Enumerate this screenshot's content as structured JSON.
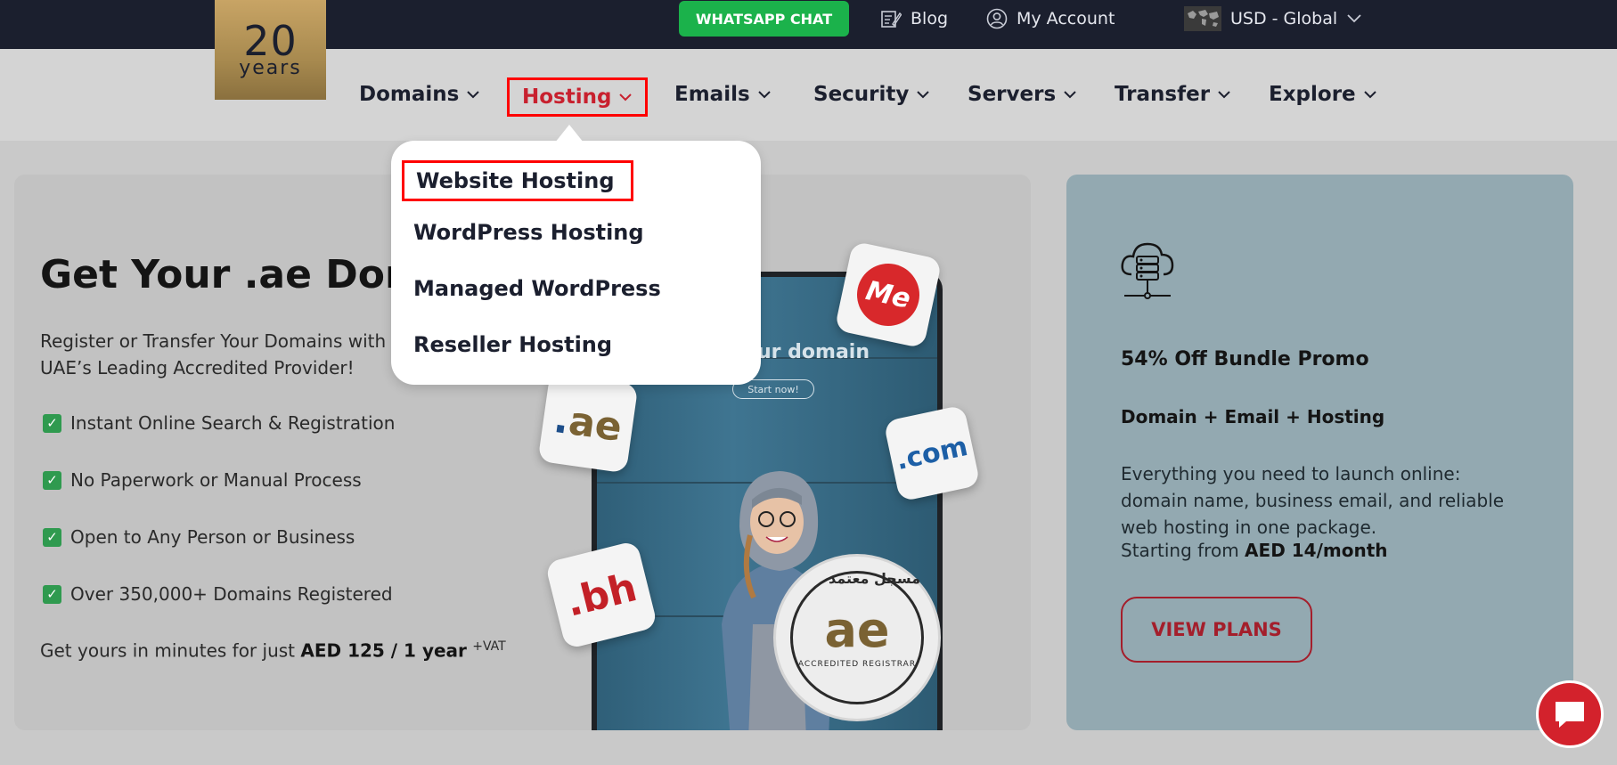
{
  "topbar": {
    "logo_number": "20",
    "logo_text": "years",
    "whatsapp_label": "WHATSAPP CHAT",
    "blog_label": "Blog",
    "account_label": "My Account",
    "currency_label": "USD - Global"
  },
  "nav": {
    "items": [
      {
        "label": "Domains"
      },
      {
        "label": "Hosting"
      },
      {
        "label": "Emails"
      },
      {
        "label": "Security"
      },
      {
        "label": "Servers"
      },
      {
        "label": "Transfer"
      },
      {
        "label": "Explore"
      }
    ],
    "active_color": "#c8202e"
  },
  "dropdown": {
    "items": [
      {
        "label": "Website Hosting"
      },
      {
        "label": "WordPress Hosting"
      },
      {
        "label": "Managed WordPress"
      },
      {
        "label": "Reseller Hosting"
      }
    ]
  },
  "hero": {
    "title": "Get Your .ae Domain",
    "subtitle": "Register or Transfer Your Domains with UAE’s Leading Accredited Provider!",
    "features": [
      "Instant Online Search & Registration",
      "No Paperwork or Manual Process",
      "Open to Any Person or Business",
      "Over 350,000+ Domains Registered"
    ],
    "price_prefix": "Get yours in minutes for just",
    "price_value": "AED 125 / 1 year",
    "price_suffix": "+VAT",
    "phone_text": "ur domain",
    "phone_button": "Start now!",
    "tile_me": "Me",
    "tile_ae": "ae",
    "tile_com": "com",
    "tile_bh": "bh",
    "seal_ae": "ae",
    "seal_text": "ACCREDITED REGISTRAR",
    "seal_arabic": "مسجل معتمد"
  },
  "promo": {
    "title": "54% Off Bundle Promo",
    "subtitle": "Domain + Email + Hosting",
    "description": "Everything you need to launch online: domain name, business email, and reliable web hosting in one package.",
    "starting_prefix": "Starting from",
    "starting_value": "AED 14/month",
    "button_label": "VIEW PLANS",
    "button_color": "#a41e2b"
  },
  "colors": {
    "topbar_bg": "#1b1f2e",
    "whatsapp_green": "#1bb24b",
    "check_green": "#2f9a4f",
    "chat_red": "#d3222c"
  }
}
